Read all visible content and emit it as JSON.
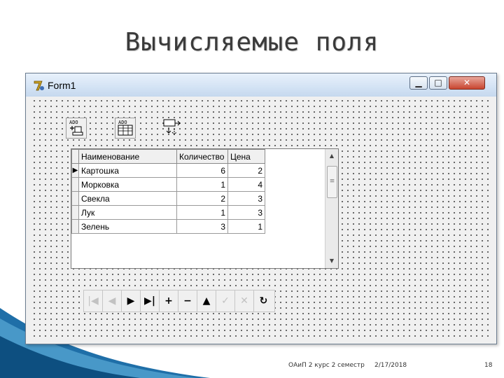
{
  "slide": {
    "title": "Вычисляемые поля",
    "footer": {
      "course": "ОАиП 2 курс 2 семестр",
      "date": "2/17/2018",
      "page": "18"
    }
  },
  "window": {
    "title": "Form1",
    "controls": {
      "minimize": "▁",
      "maximize": "□",
      "close": "✕"
    }
  },
  "components": [
    {
      "label": "ADO",
      "icon": "ado-connection-icon"
    },
    {
      "label": "ADO",
      "icon": "ado-table-icon"
    },
    {
      "label": "",
      "icon": "datasource-icon"
    }
  ],
  "grid": {
    "columns": [
      "Наименование",
      "Количество",
      "Цена"
    ],
    "rows": [
      {
        "name": "Картошка",
        "qty": "6",
        "price": "2",
        "current": true
      },
      {
        "name": "Морковка",
        "qty": "1",
        "price": "4",
        "current": false
      },
      {
        "name": "Свекла",
        "qty": "2",
        "price": "3",
        "current": false
      },
      {
        "name": "Лук",
        "qty": "1",
        "price": "3",
        "current": false
      },
      {
        "name": "Зелень",
        "qty": "3",
        "price": "1",
        "current": false
      }
    ],
    "current_row_marker": "▶"
  },
  "navigator": {
    "buttons": [
      {
        "name": "first",
        "glyph": "|◀",
        "enabled": false
      },
      {
        "name": "prior",
        "glyph": "◀",
        "enabled": false
      },
      {
        "name": "next",
        "glyph": "▶",
        "enabled": true
      },
      {
        "name": "last",
        "glyph": "▶|",
        "enabled": true
      },
      {
        "name": "insert",
        "glyph": "+",
        "enabled": true
      },
      {
        "name": "delete",
        "glyph": "−",
        "enabled": true
      },
      {
        "name": "edit",
        "glyph": "▲",
        "enabled": true
      },
      {
        "name": "post",
        "glyph": "✓",
        "enabled": false
      },
      {
        "name": "cancel",
        "glyph": "✕",
        "enabled": false
      },
      {
        "name": "refresh",
        "glyph": "↻",
        "enabled": true
      }
    ]
  },
  "colors": {
    "accent": "#1f6fa8",
    "accent_light": "#5aa9d6"
  }
}
